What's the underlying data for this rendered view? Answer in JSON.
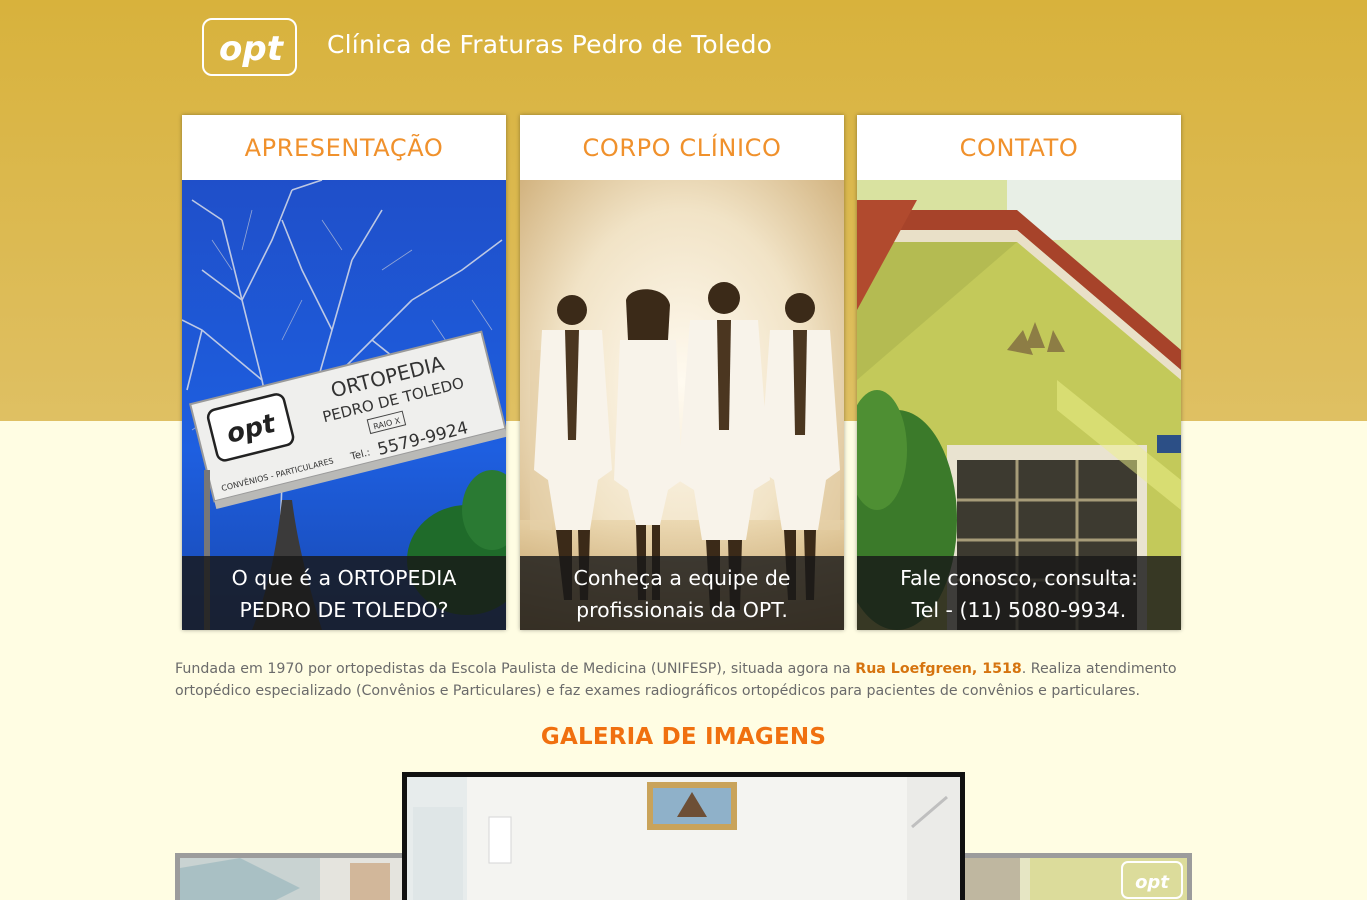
{
  "header": {
    "logo_text": "opt",
    "site_title": "Clínica de Fraturas Pedro de Toledo"
  },
  "cards": [
    {
      "title": "APRESENTAÇÃO",
      "caption_line1": "O que é a ORTOPEDIA",
      "caption_line2": "PEDRO DE TOLEDO?",
      "photo": {
        "sign_title_line1": "ORTOPEDIA",
        "sign_title_line2": "PEDRO DE TOLEDO",
        "sign_logo": "opt",
        "sign_badge": "RAIO X",
        "sign_footer": "CONVÊNIOS - PARTICULARES",
        "sign_phone_label": "Tel.:",
        "sign_phone": "5579-9924"
      }
    },
    {
      "title": "CORPO CLÍNICO",
      "caption_line1": "Conheça a equipe de",
      "caption_line2": "profissionais da OPT."
    },
    {
      "title": "CONTATO",
      "caption_line1": "Fale conosco, consulta:",
      "caption_line2": "Tel - (11) 5080-9934."
    }
  ],
  "description": {
    "text_before": "Fundada em 1970 por ortopedistas da Escola Paulista de Medicina (UNIFESP), situada agora na ",
    "address": "Rua Loefgreen, 1518",
    "text_after": ". Realiza atendimento ortopédico especializado (Convênios e Particulares) e faz exames radiográficos ortopédicos para pacientes de convênios e particulares."
  },
  "gallery": {
    "title": "GALERIA DE IMAGENS",
    "side_logo": "opt"
  },
  "colors": {
    "header_gold": "#d8b23c",
    "page_cream": "#fffde3",
    "accent_orange": "#f0912c",
    "address_orange": "#d6740f"
  }
}
